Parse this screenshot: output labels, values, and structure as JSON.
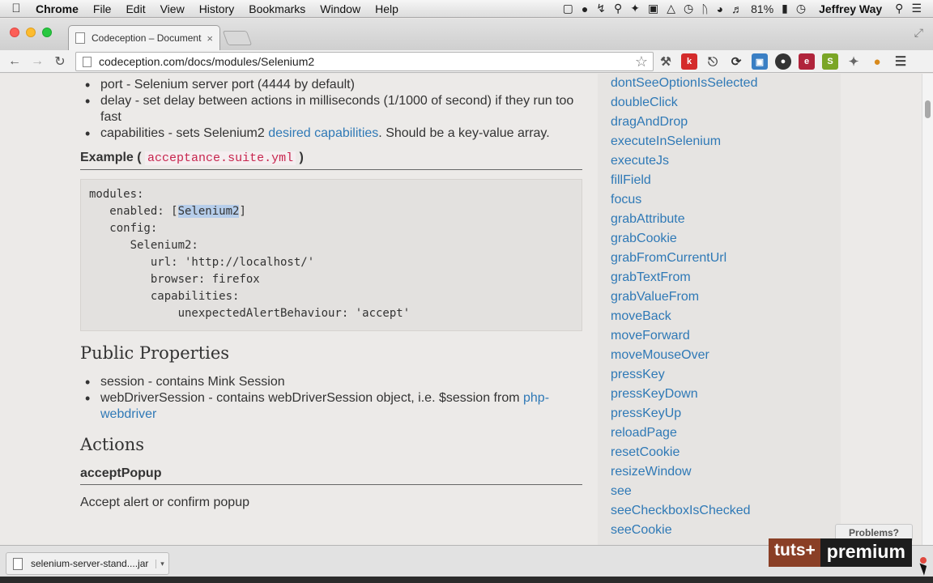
{
  "menubar": {
    "apple": "",
    "app": "Chrome",
    "items": [
      "File",
      "Edit",
      "View",
      "History",
      "Bookmarks",
      "Window",
      "Help"
    ],
    "battery": "81%",
    "user": "Jeffrey Way"
  },
  "tab": {
    "title": "Codeception – Documenta",
    "close": "×"
  },
  "address": {
    "host": "codeception.com",
    "path": "/docs/modules/Selenium2"
  },
  "content": {
    "bullets_top": [
      {
        "text": "port - Selenium server port (4444 by default)"
      },
      {
        "text": "delay - set delay between actions in milliseconds (1/1000 of second) if they run too fast"
      },
      {
        "pre": "capabilities - sets Selenium2 ",
        "link": "desired capabilities",
        "post": ". Should be a key-value array."
      }
    ],
    "example_label": "Example (",
    "example_code": "acceptance.suite.yml",
    "example_close": ")",
    "code": {
      "l1": "modules:",
      "l2a": "   enabled: [",
      "l2sel": "Selenium2",
      "l2b": "]",
      "l3": "   config:",
      "l4": "      Selenium2:",
      "l5": "         url: 'http://localhost/'",
      "l6": "         browser: firefox",
      "l7": "         capabilities:",
      "l8": "             unexpectedAlertBehaviour: 'accept'"
    },
    "public_properties": "Public Properties",
    "props": [
      {
        "text": "session - contains Mink Session"
      },
      {
        "pre": "webDriverSession - contains webDriverSession object, i.e. $session from ",
        "link": "php-webdriver"
      }
    ],
    "actions": "Actions",
    "accept_popup": "acceptPopup",
    "accept_desc": "Accept alert or confirm popup"
  },
  "sidebar": [
    "dontSeeOptionIsSelected",
    "doubleClick",
    "dragAndDrop",
    "executeInSelenium",
    "executeJs",
    "fillField",
    "focus",
    "grabAttribute",
    "grabCookie",
    "grabFromCurrentUrl",
    "grabTextFrom",
    "grabValueFrom",
    "moveBack",
    "moveForward",
    "moveMouseOver",
    "pressKey",
    "pressKeyDown",
    "pressKeyUp",
    "reloadPage",
    "resetCookie",
    "resizeWindow",
    "see",
    "seeCheckboxIsChecked",
    "seeCookie"
  ],
  "problems": "Problems?",
  "download": {
    "name": "selenium-server-stand....jar",
    "arrow": "▾"
  },
  "watermark": {
    "plus": "tuts+",
    "premium": "premium"
  }
}
